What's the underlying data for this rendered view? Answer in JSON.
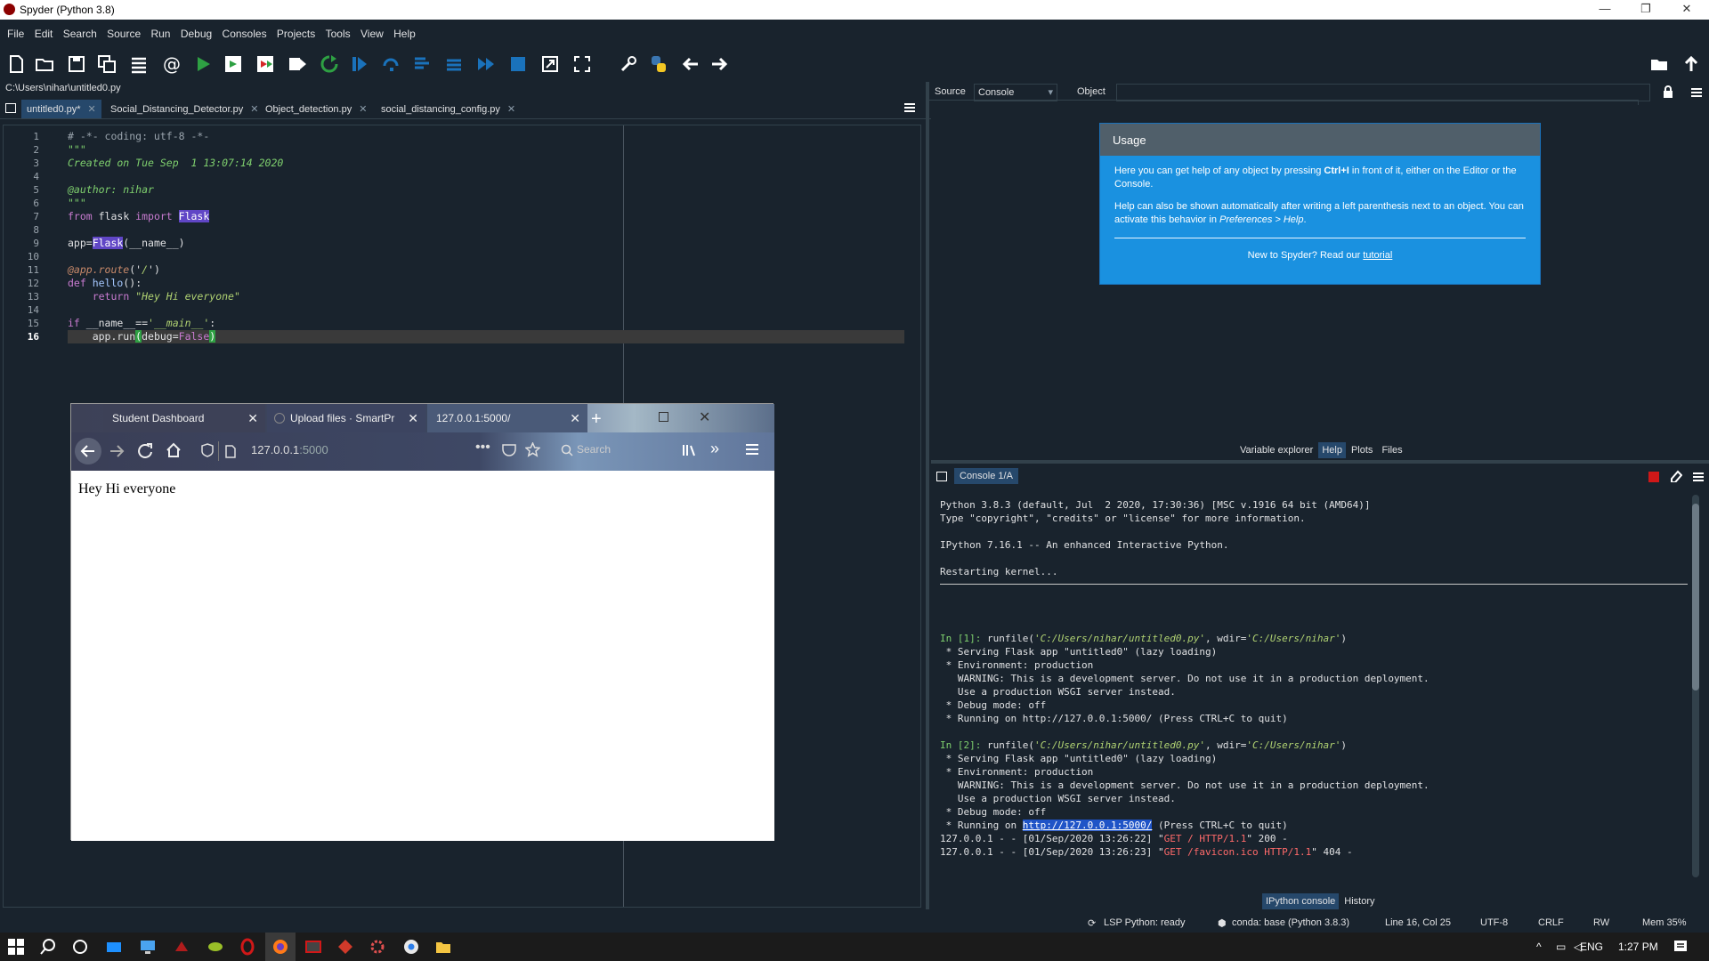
{
  "window": {
    "title": "Spyder (Python 3.8)"
  },
  "menu": [
    "File",
    "Edit",
    "Search",
    "Source",
    "Run",
    "Debug",
    "Consoles",
    "Projects",
    "Tools",
    "View",
    "Help"
  ],
  "toolbar": {
    "path": "C:\\Users\\nihar"
  },
  "editor": {
    "file_path": "C:\\Users\\nihar\\untitled0.py",
    "tabs": [
      {
        "label": "untitled0.py*"
      },
      {
        "label": "Social_Distancing_Detector.py"
      },
      {
        "label": "Object_detection.py"
      },
      {
        "label": "social_distancing_config.py"
      }
    ],
    "line_numbers": [
      "1",
      "2",
      "3",
      "4",
      "5",
      "6",
      "7",
      "8",
      "9",
      "10",
      "11",
      "12",
      "13",
      "14",
      "15",
      "16"
    ],
    "lines": {
      "l1": "# -*- coding: utf-8 -*-",
      "l2": "\"\"\"",
      "l3": "Created on Tue Sep  1 13:07:14 2020",
      "l5": "@author: nihar",
      "l6": "\"\"\"",
      "l7a": "from",
      "l7b": " flask ",
      "l7c": "import",
      "l7d": " ",
      "l7e": "Flask",
      "l9a": "app=",
      "l9b": "Flask",
      "l9c": "(__name__)",
      "l11a": "@app.route",
      "l11b": "('",
      "l11c": "/",
      "l11d": "')",
      "l12a": "def",
      "l12b": " ",
      "l12c": "hello",
      "l12d": "():",
      "l13a": "    ",
      "l13b": "return",
      "l13c": " ",
      "l13d": "\"Hey Hi everyone\"",
      "l15a": "if",
      "l15b": " __name__==",
      "l15c": "'__main__'",
      "l15d": ":",
      "l16a": "    app.run",
      "l16b": "(",
      "l16c": "debug=",
      "l16d": "False",
      "l16e": ")"
    }
  },
  "help_pane": {
    "source_label": "Source",
    "source_value": "Console",
    "object_label": "Object",
    "usage_title": "Usage",
    "usage_p1a": "Here you can get help of any object by pressing ",
    "usage_p1b": "Ctrl+I",
    "usage_p1c": " in front of it, either on the Editor or the Console.",
    "usage_p2a": "Help can also be shown automatically after writing a left parenthesis next to an object. You can activate this behavior in ",
    "usage_p2b": "Preferences > Help",
    "usage_p2c": ".",
    "usage_p3a": "New to Spyder? Read our ",
    "usage_p3b": "tutorial",
    "tabs": [
      "Variable explorer",
      "Help",
      "Plots",
      "Files"
    ]
  },
  "console": {
    "tab_label": "Console 1/A",
    "lines": {
      "c1": "Python 3.8.3 (default, Jul  2 2020, 17:30:36) [MSC v.1916 64 bit (AMD64)]",
      "c2": "Type \"copyright\", \"credits\" or \"license\" for more information.",
      "c4": "IPython 7.16.1 -- An enhanced Interactive Python.",
      "c6": "Restarting kernel...",
      "p1a": "In [1]: ",
      "p1b": "runfile(",
      "p1c": "'C:/Users/nihar/untitled0.py'",
      "p1d": ", wdir=",
      "p1e": "'C:/Users/nihar'",
      "p1f": ")",
      "o1": " * Serving Flask app \"untitled0\" (lazy loading)",
      "o2": " * Environment: production",
      "o3": "   WARNING: This is a development server. Do not use it in a production deployment.",
      "o4": "   Use a production WSGI server instead.",
      "o5": " * Debug mode: off",
      "o6": " * Running on http://127.0.0.1:5000/ (Press CTRL+C to quit)",
      "p2a": "In [2]: ",
      "q6a": " * Running on ",
      "q6b": "http://127.0.0.1:5000/",
      "q6c": " (Press CTRL+C to quit)",
      "r1a": "127.0.0.1 - - [01/Sep/2020 13:26:22] \"",
      "r1b": "GET / HTTP/1.1",
      "r1c": "\" 200 -",
      "r2a": "127.0.0.1 - - [01/Sep/2020 13:26:23] \"",
      "r2b": "GET /favicon.ico HTTP/1.1",
      "r2c": "\" 404 -"
    },
    "bottom_tabs": [
      "IPython console",
      "History"
    ]
  },
  "statusbar": {
    "lsp": "LSP Python: ready",
    "conda": "conda: base (Python 3.8.3)",
    "cursor": "Line 16, Col 25",
    "encoding": "UTF-8",
    "eol": "CRLF",
    "perm": "RW",
    "mem": "Mem 35%"
  },
  "browser": {
    "tabs": [
      "Student Dashboard",
      "Upload files · SmartPr",
      "127.0.0.1:5000/"
    ],
    "url_host": "127.0.0.1",
    "url_port": ":5000",
    "search_placeholder": "Search",
    "page_text": "Hey Hi everyone"
  },
  "taskbar": {
    "lang": "ENG",
    "time": "1:27 PM"
  },
  "colors": {
    "accent": "#26486b",
    "help_blue": "#1a91e0",
    "run_green": "#2ea043"
  }
}
